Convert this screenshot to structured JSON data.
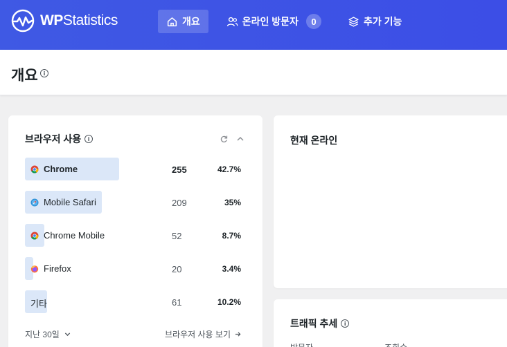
{
  "brand": {
    "logo_text_bold": "WP",
    "logo_text_rest": "Statistics"
  },
  "nav": {
    "items": [
      {
        "label": "개요",
        "icon": "home-icon",
        "active": true
      },
      {
        "label": "온라인 방문자",
        "icon": "users-icon",
        "count": "0"
      },
      {
        "label": "추가 기능",
        "icon": "layers-icon"
      }
    ]
  },
  "header": {
    "title": "개요",
    "info": "i"
  },
  "browsers_card": {
    "title": "브라우저 사용",
    "info": "i",
    "rows": [
      {
        "name": "Chrome",
        "count": "255",
        "percent": "42.7%",
        "share": 0.427,
        "icon": "chrome-icon"
      },
      {
        "name": "Mobile Safari",
        "count": "209",
        "percent": "35%",
        "share": 0.35,
        "icon": "safari-icon"
      },
      {
        "name": "Chrome Mobile",
        "count": "52",
        "percent": "8.7%",
        "share": 0.087,
        "icon": "chrome-icon"
      },
      {
        "name": "Firefox",
        "count": "20",
        "percent": "3.4%",
        "share": 0.034,
        "icon": "firefox-icon"
      },
      {
        "name": "기타",
        "count": "61",
        "percent": "10.2%",
        "share": 0.102
      }
    ],
    "period": "지난 30일",
    "view_link": "브라우저 사용 보기"
  },
  "online_card": {
    "title": "현재 온라인"
  },
  "traffic_card": {
    "title": "트래픽 추세",
    "info": "i",
    "sub_left": "방문자",
    "sub_right": "조회수"
  },
  "colors": {
    "topbar": "#3f59e4",
    "bar": "#dbe7f8",
    "card_bg": "#ffffff",
    "page_bg": "#f0f0f1"
  }
}
